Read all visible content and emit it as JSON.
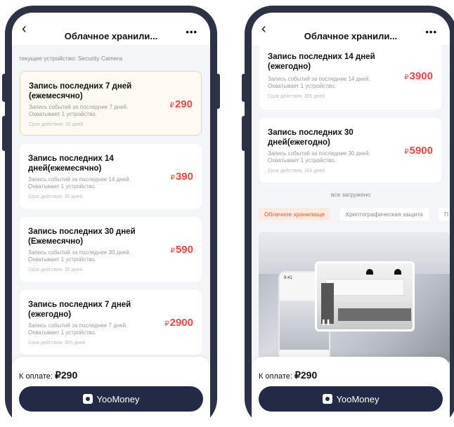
{
  "left": {
    "title": "Облачное хранили...",
    "device_label": "текущее устройство: Security Camera",
    "cards": [
      {
        "title": "Запись последних 7 дней (ежемесячно)",
        "desc": "Запись событий за последние 7 дней. Охватывает 1 устройство.",
        "term": "Срок действия: 30 дней",
        "currency": "₽",
        "price": "290",
        "selected": true
      },
      {
        "title": "Запись последних 14 дней(ежемесячно)",
        "desc": "Запись событий за последние 14 дней. Охватывает 1 устройство.",
        "term": "Срок действия: 30 дней",
        "currency": "₽",
        "price": "390",
        "selected": false
      },
      {
        "title": "Запись последних 30 дней (Ежемесячно)",
        "desc": "Запись событий за последние 30 дней. Охватывает 1 устройство.",
        "term": "Срок действия: 30 дней",
        "currency": "₽",
        "price": "590",
        "selected": false
      },
      {
        "title": "Запись последних 7 дней (ежегодно)",
        "desc": "Запись событий за последние 7 дней. Охватывает 1 устройство.",
        "term": "Срок действия: 365 дней",
        "currency": "₽",
        "price": "2900",
        "selected": false
      }
    ],
    "pay_label": "К оплате:",
    "pay_amount": "₽290",
    "pay_button": "YooMoney"
  },
  "right": {
    "title": "Облачное хранили...",
    "cards": [
      {
        "title": "Запись последних 14 дней (ежегодно)",
        "desc": "Запись событий за последние 14 дней. Охватывает 1 устройство.",
        "term": "Срок действия: 365 дней",
        "currency": "₽",
        "price": "3900"
      },
      {
        "title": "Запись последних 30 дней(ежегодно)",
        "desc": "Запись событий за последние 30 дней. Охватывает 1 устройство.",
        "term": "Срок действия: 365 дней",
        "currency": "₽",
        "price": "5900"
      }
    ],
    "loaded_text": "все загружено",
    "tabs": [
      "Облачное хранилище",
      "Криптографическая защита",
      "П"
    ],
    "promo_time": "9:41",
    "pay_label": "К оплате:",
    "pay_amount": "₽290",
    "pay_button": "YooMoney"
  },
  "icons": {
    "back": "back-chevron-icon",
    "more": "more-dots-icon",
    "pay": "yoomoney-logo-icon"
  },
  "colors": {
    "frame": "#2d3346",
    "price": "#e94545",
    "pay_button": "#232a45",
    "active_tab": "#e2562a"
  }
}
